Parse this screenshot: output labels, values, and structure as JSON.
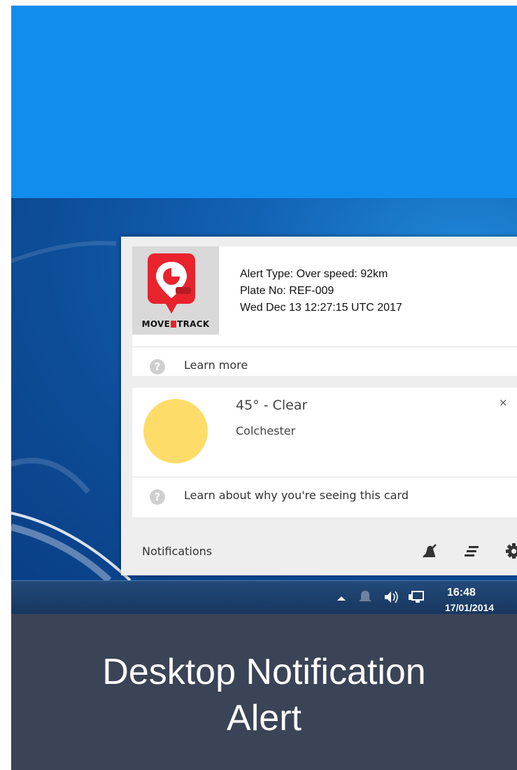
{
  "caption": {
    "line1": "Desktop Notification",
    "line2": "Alert"
  },
  "alert": {
    "brand": "MOVE TRACK",
    "brand_left": "MOVE",
    "brand_right": "TRACK",
    "lines": [
      "Alert Type: Over speed: 92km",
      "Plate No: REF-009",
      "Wed Dec 13 12:27:15 UTC 2017"
    ],
    "help_label": "Learn more"
  },
  "weather": {
    "temperature": "45° - Clear",
    "location": "Colchester",
    "close_label": "×",
    "help_label": "Learn about why you're seeing this card"
  },
  "footer": {
    "label": "Notifications"
  },
  "taskbar": {
    "clock": "16:48",
    "date": "17/01/2014"
  },
  "colors": {
    "brand_red": "#e8232d",
    "sun": "#fddc6a",
    "caption_bg": "#3a4456",
    "top_blue": "#118dee"
  },
  "icons": [
    "help-icon",
    "mute-icon",
    "clear-all-icon",
    "settings-icon",
    "tray-arrow-icon",
    "bell-icon",
    "volume-icon",
    "network-icon"
  ]
}
